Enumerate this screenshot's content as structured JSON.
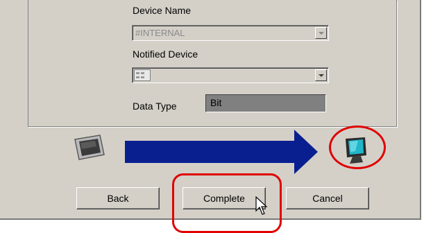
{
  "device_name": {
    "label": "Device Name",
    "value": "#INTERNAL"
  },
  "notified_device": {
    "label": "Notified Device",
    "value": ""
  },
  "data_type": {
    "label": "Data Type",
    "value": "Bit"
  },
  "buttons": {
    "back": "Back",
    "complete": "Complete",
    "cancel": "Cancel"
  },
  "icons": {
    "source": "display-panel-icon",
    "arrow": "transfer-arrow-icon",
    "target": "monitor-icon",
    "notified": "device-list-icon",
    "cursor": "mouse-pointer-icon"
  },
  "colors": {
    "arrow": "#0a1f8f",
    "highlight": "#e00000",
    "dialog": "#d4d0c8"
  }
}
